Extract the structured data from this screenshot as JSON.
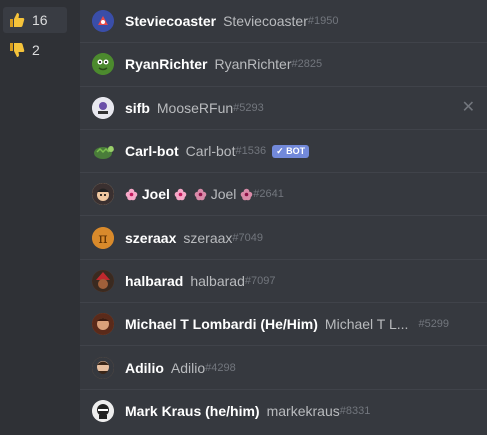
{
  "reactions": [
    {
      "icon": "thumbs-up-icon",
      "count": "16",
      "selected": true
    },
    {
      "icon": "thumbs-down-icon",
      "count": "2",
      "selected": false
    }
  ],
  "users": [
    {
      "nickname": "Steviecoaster",
      "username": "Steviecoaster",
      "discriminator": "#1950",
      "avatar_color": "#3a4ea8"
    },
    {
      "nickname": "RyanRichter",
      "username": "RyanRichter",
      "discriminator": "#2825",
      "avatar_color": "#4c8a2e"
    },
    {
      "nickname": "sifb",
      "username": "MooseRFun",
      "discriminator": "#5293",
      "avatar_color": "#e8e8ef",
      "close_visible": true
    },
    {
      "nickname": "Carl-bot",
      "username": "Carl-bot",
      "discriminator": "#1536",
      "avatar_color": "#4a7d3a",
      "bot_tag": "BOT"
    },
    {
      "nickname": "Joel",
      "username": "Joel",
      "discriminator": "#2641",
      "avatar_color": "#d9b48a"
    },
    {
      "nickname": "szeraax",
      "username": "szeraax",
      "discriminator": "#7049",
      "avatar_color": "#d98a2b"
    },
    {
      "nickname": "halbarad",
      "username": "halbarad",
      "discriminator": "#7097",
      "avatar_color": "#7a3a1a"
    },
    {
      "nickname": "Michael T Lombardi (He/Him)",
      "username": "Michael T L...",
      "discriminator": "#5299",
      "avatar_color": "#a0522d"
    },
    {
      "nickname": "Adilio",
      "username": "Adilio",
      "discriminator": "#4298",
      "avatar_color": "#8b6a4e"
    },
    {
      "nickname": "Mark Kraus (he/him)",
      "username": "markekraus",
      "discriminator": "#8331",
      "avatar_color": "#d9d9d9"
    }
  ],
  "colors": {
    "bot_tag": "#7289da",
    "flower": "#f7a8c8"
  }
}
